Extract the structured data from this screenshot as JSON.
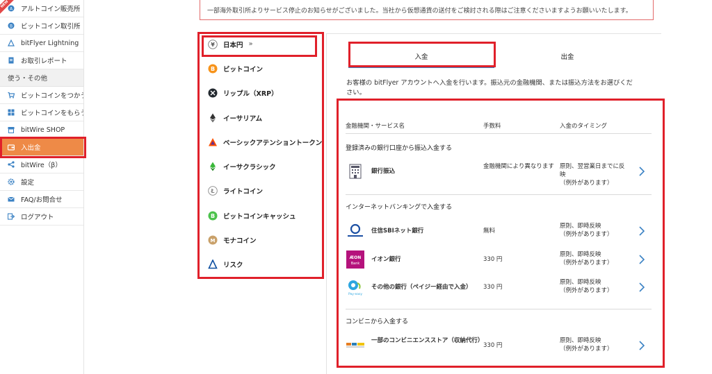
{
  "sidebar": {
    "items_top": [
      {
        "label": "アルトコイン販売所",
        "icon": "altcoin-icon",
        "new": true
      },
      {
        "label": "ビットコイン取引所",
        "icon": "bitcoin-exchange-icon"
      },
      {
        "label": "bitFlyer Lightning",
        "icon": "lightning-icon"
      },
      {
        "label": "お取引レポート",
        "icon": "report-icon"
      }
    ],
    "section_label": "使う・その他",
    "items_bottom": [
      {
        "label": "ビットコインをつかう",
        "icon": "cart-icon"
      },
      {
        "label": "ビットコインをもらう",
        "icon": "gift-icon"
      },
      {
        "label": "bitWire SHOP",
        "icon": "shop-icon"
      },
      {
        "label": "入出金",
        "icon": "wallet-icon",
        "active": true
      },
      {
        "label": "bitWire（β）",
        "icon": "share-icon"
      },
      {
        "label": "設定",
        "icon": "gear-icon"
      },
      {
        "label": "FAQ/お問合せ",
        "icon": "mail-icon"
      },
      {
        "label": "ログアウト",
        "icon": "logout-icon"
      }
    ],
    "new_badge": "NEW"
  },
  "notice": "一部海外取引所よりサービス停止のお知らせがございました。当社から仮想通貨の送付をご検討される際はご注意くださいますようお願いいたします。",
  "currencies": [
    {
      "label": "日本円",
      "icon": "yen-icon",
      "selected": true,
      "chevron": "»"
    },
    {
      "label": "ビットコイン",
      "icon": "bitcoin-icon"
    },
    {
      "label": "リップル（XRP）",
      "icon": "ripple-icon"
    },
    {
      "label": "イーサリアム",
      "icon": "ethereum-icon"
    },
    {
      "label": "ベーシックアテンショントークン",
      "icon": "bat-icon"
    },
    {
      "label": "イーサクラシック",
      "icon": "ethereum-classic-icon"
    },
    {
      "label": "ライトコイン",
      "icon": "litecoin-icon"
    },
    {
      "label": "ビットコインキャッシュ",
      "icon": "bitcoin-cash-icon"
    },
    {
      "label": "モナコイン",
      "icon": "monacoin-icon"
    },
    {
      "label": "リスク",
      "icon": "lisk-icon"
    }
  ],
  "tabs": {
    "deposit": "入金",
    "withdraw": "出金"
  },
  "intro": "お客様の bitFlyer アカウントへ入金を行います。振込元の金融機関、または振込方法をお選びください。",
  "table_head": {
    "service": "金融機関・サービス名",
    "fee": "手数料",
    "timing": "入金のタイミング"
  },
  "sections": [
    {
      "title": "登録済みの銀行口座から振込入金する",
      "rows": [
        {
          "name": "銀行振込",
          "fee": "金融機関により異なります",
          "timing": "原則、翌営業日までに反映\n（例外があります）",
          "logo": "bank-building-icon"
        }
      ]
    },
    {
      "title": "インターネットバンキングで入金する",
      "rows": [
        {
          "name": "住信SBIネット銀行",
          "fee": "無料",
          "timing": "原則、即時反映\n（例外があります）",
          "logo": "sbi-bank-logo"
        },
        {
          "name": "イオン銀行",
          "fee": "330 円",
          "timing": "原則、即時反映\n（例外があります）",
          "logo": "aeon-bank-logo",
          "logo_text": [
            "ÆON",
            "Bank"
          ]
        },
        {
          "name": "その他の銀行（ペイジー経由で入金）",
          "fee": "330 円",
          "timing": "原則、即時反映\n（例外があります）",
          "logo": "pay-easy-logo",
          "logo_text": [
            "Pay-easy"
          ]
        }
      ]
    },
    {
      "title": "コンビニから入金する",
      "rows": [
        {
          "name": "一部のコンビニエンスストア（収納代行）",
          "fee": "330 円",
          "timing": "原則、即時反映\n（例外があります）",
          "logo": "convenience-store-logo"
        }
      ]
    }
  ],
  "colors": {
    "accent": "#ee8a47",
    "highlight": "#e0202a",
    "tab_line": "#3b82c4",
    "link_arrow": "#3b82c4"
  }
}
